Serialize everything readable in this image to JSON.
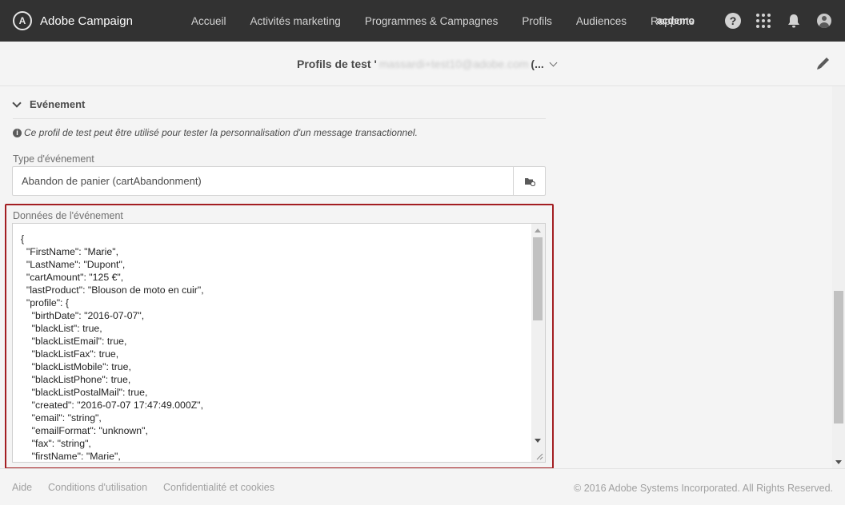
{
  "app": {
    "name": "Adobe Campaign",
    "logo_glyph": "A"
  },
  "nav": {
    "items": [
      {
        "label": "Accueil"
      },
      {
        "label": "Activités marketing"
      },
      {
        "label": "Programmes & Campagnes"
      },
      {
        "label": "Profils"
      },
      {
        "label": "Audiences"
      },
      {
        "label": "Rapports"
      }
    ]
  },
  "topbar": {
    "user": "acdemo",
    "help_glyph": "?"
  },
  "titlebar": {
    "title_prefix": "Profils de test '",
    "title_blurred": "massardi+test10@adobe.com",
    "title_suffix": " (..."
  },
  "section": {
    "title": "Evénement",
    "info_glyph": "i",
    "info": "Ce profil de test peut être utilisé pour tester la personnalisation d'un message transactionnel."
  },
  "event_type": {
    "label": "Type d'événement",
    "value": "Abandon de panier (cartAbandonment)"
  },
  "event_data": {
    "label": "Données de l'événement",
    "content": "{\n  \"FirstName\": \"Marie\",\n  \"LastName\": \"Dupont\",\n  \"cartAmount\": \"125 €\",\n  \"lastProduct\": \"Blouson de moto en cuir\",\n  \"profile\": {\n    \"birthDate\": \"2016-07-07\",\n    \"blackList\": true,\n    \"blackListEmail\": true,\n    \"blackListFax\": true,\n    \"blackListMobile\": true,\n    \"blackListPhone\": true,\n    \"blackListPostalMail\": true,\n    \"created\": \"2016-07-07 17:47:49.000Z\",\n    \"email\": \"string\",\n    \"emailFormat\": \"unknown\",\n    \"fax\": \"string\",\n    \"firstName\": \"Marie\","
  },
  "footer": {
    "links": [
      {
        "label": "Aide"
      },
      {
        "label": "Conditions d'utilisation"
      },
      {
        "label": "Confidentialité et cookies"
      }
    ],
    "copyright": "© 2016 Adobe Systems Incorporated. All Rights Reserved."
  },
  "colors": {
    "topbar": "#323232",
    "highlight": "#a31e22",
    "background": "#f4f4f4"
  }
}
